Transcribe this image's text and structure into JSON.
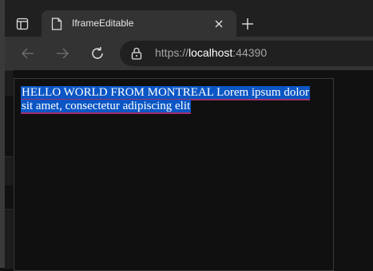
{
  "browser": {
    "tab": {
      "title": "IframeEditable",
      "favicon": "page-icon"
    },
    "toolbar": {
      "back_icon": "arrow-left-icon",
      "forward_icon": "arrow-right-icon",
      "refresh_icon": "refresh-icon"
    },
    "address": {
      "scheme": "https://",
      "host": "localhost",
      "port": ":44390",
      "lock_icon": "lock-icon"
    }
  },
  "editor": {
    "text": "HELLO WORLD FROM MONTREAL Lorem ipsum dolor sit amet, consectetur adipiscing elit",
    "selection_color": "#0b56c4"
  }
}
